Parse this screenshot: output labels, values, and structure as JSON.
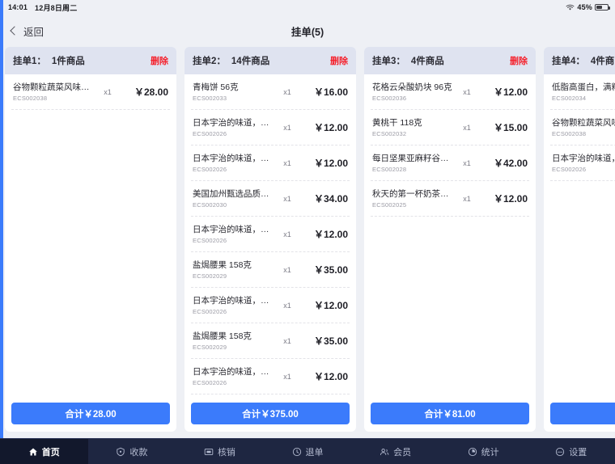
{
  "statusbar": {
    "time": "14:01",
    "date": "12月8日周二",
    "wifi_icon": "wifi-icon",
    "battery_percent": "45%",
    "battery_level": 45
  },
  "header": {
    "back_label": "返回",
    "back_icon": "chevron-left-icon",
    "title": "挂单(5)"
  },
  "colors": {
    "accent": "#3b7bfb",
    "danger": "#f5222d",
    "card_header_bg": "#dfe3f0",
    "page_bg": "#eef0f5",
    "tabbar_bg": "#1e2641",
    "tab_active_bg": "#12182c"
  },
  "cards": [
    {
      "title": "挂单1：",
      "count_label": "1件商品",
      "delete_label": "删除",
      "total_label": "合计￥28.00",
      "items": [
        {
          "name": "谷物颗粒蔬菜风味牛奶面包 …",
          "code": "ECS002038",
          "qty": "x1",
          "price": "￥28.00"
        }
      ]
    },
    {
      "title": "挂单2：",
      "count_label": "14件商品",
      "delete_label": "删除",
      "total_label": "合计￥375.00",
      "items": [
        {
          "name": "青梅饼 56克",
          "code": "ECS002033",
          "qty": "x1",
          "price": "￥16.00"
        },
        {
          "name": "日本宇治的味道，抹茶拿铁…",
          "code": "ECS002026",
          "qty": "x1",
          "price": "￥12.00"
        },
        {
          "name": "日本宇治的味道，抹茶拿铁…",
          "code": "ECS002026",
          "qty": "x1",
          "price": "￥12.00"
        },
        {
          "name": "美国加州甄选品质，原香大…",
          "code": "ECS002030",
          "qty": "x1",
          "price": "￥34.00"
        },
        {
          "name": "日本宇治的味道，抹茶拿铁…",
          "code": "ECS002026",
          "qty": "x1",
          "price": "￥12.00"
        },
        {
          "name": "盐焗腰果 158克",
          "code": "ECS002029",
          "qty": "x1",
          "price": "￥35.00"
        },
        {
          "name": "日本宇治的味道，抹茶拿铁…",
          "code": "ECS002026",
          "qty": "x1",
          "price": "￥12.00"
        },
        {
          "name": "盐焗腰果 158克",
          "code": "ECS002029",
          "qty": "x1",
          "price": "￥35.00"
        },
        {
          "name": "日本宇治的味道，抹茶拿铁…",
          "code": "ECS002026",
          "qty": "x1",
          "price": "￥12.00"
        }
      ]
    },
    {
      "title": "挂单3：",
      "count_label": "4件商品",
      "delete_label": "删除",
      "total_label": "合计￥81.00",
      "items": [
        {
          "name": "花格云朵酸奶块 96克",
          "code": "ECS002036",
          "qty": "x1",
          "price": "￥12.00"
        },
        {
          "name": "黄桃干 118克",
          "code": "ECS002032",
          "qty": "x1",
          "price": "￥15.00"
        },
        {
          "name": "每日坚果亚麻籽谷物燕麦片 …",
          "code": "ECS002028",
          "qty": "x1",
          "price": "￥42.00"
        },
        {
          "name": "秋天的第一杯奶茶味，芝芝…",
          "code": "ECS002025",
          "qty": "x1",
          "price": "￥12.00"
        }
      ]
    },
    {
      "title": "挂单4：",
      "count_label": "4件商",
      "delete_label": "",
      "total_label": "",
      "items": [
        {
          "name": "低脂高蛋白，满籽蕉",
          "code": "ECS002034",
          "qty": "",
          "price": ""
        },
        {
          "name": "谷物颗粒蔬菜风味牛",
          "code": "ECS002038",
          "qty": "",
          "price": ""
        },
        {
          "name": "日本宇治的味道，抹",
          "code": "ECS002026",
          "qty": "",
          "price": ""
        }
      ]
    }
  ],
  "tabbar": {
    "items": [
      {
        "label": "首页",
        "icon": "home-icon",
        "active": true
      },
      {
        "label": "收款",
        "icon": "wallet-icon",
        "active": false
      },
      {
        "label": "核销",
        "icon": "ticket-icon",
        "active": false
      },
      {
        "label": "退单",
        "icon": "refund-icon",
        "active": false
      },
      {
        "label": "会员",
        "icon": "member-icon",
        "active": false
      },
      {
        "label": "统计",
        "icon": "clock-chart-icon",
        "active": false
      },
      {
        "label": "设置",
        "icon": "settings-icon",
        "active": false
      }
    ]
  }
}
